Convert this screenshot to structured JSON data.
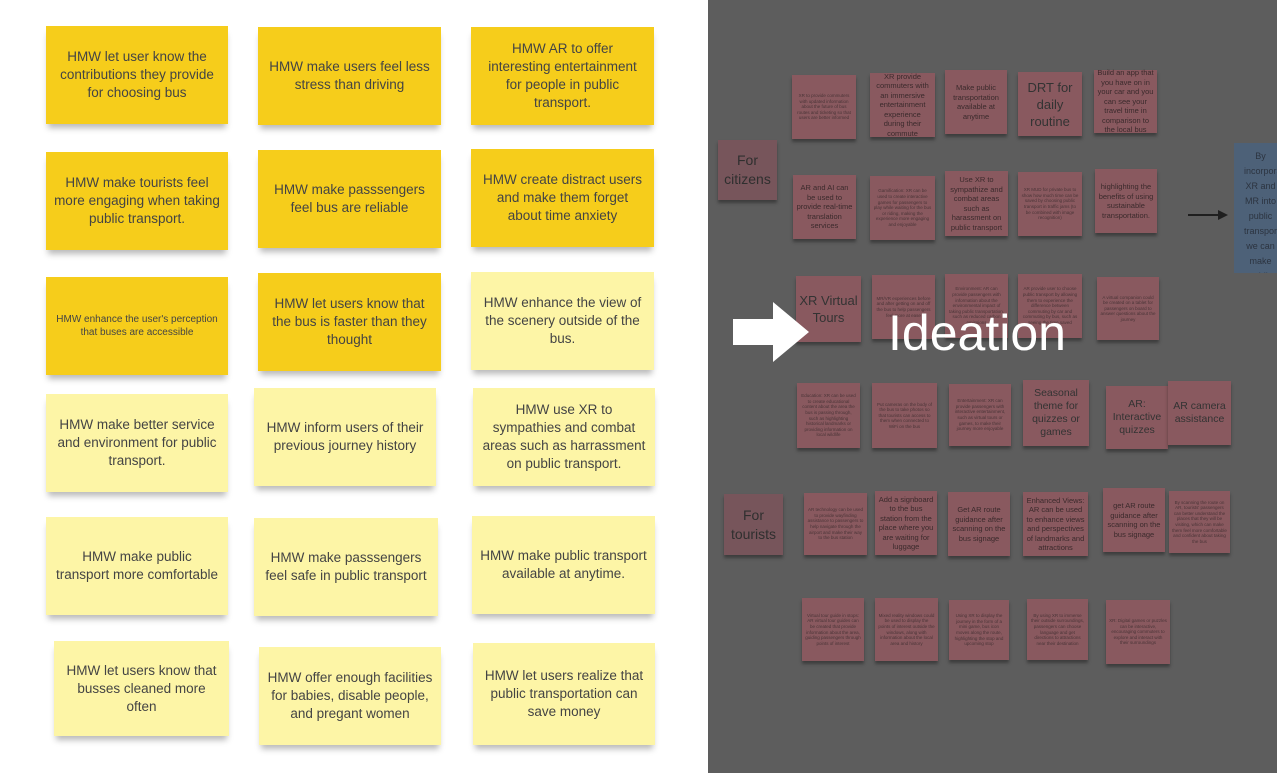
{
  "hmw_notes": [
    "HMW let user know the contributions they provide for choosing bus",
    "HMW make users feel less stress than driving",
    "HMW AR to offer interesting entertainment for people in public transport.",
    "HMW make tourists feel more engaging when taking public transport.",
    "HMW make passsengers feel bus are reliable",
    "HMW create distract users and make them forget about time anxiety",
    "HMW enhance the user's perception that buses are accessible",
    "HMW let users know that the bus is faster than they thought",
    "HMW enhance the view of the scenery outside of the bus.",
    "HMW make better service and environment for public transport.",
    "HMW inform users of their previous journey history",
    "HMW use XR to sympathies and combat areas such as harrassment on public transport.",
    "HMW make public transport more comfortable",
    "HMW make passsengers feel safe in public transport",
    "HMW make public transport available at anytime.",
    "HMW let users know that busses cleaned more often",
    "HMW offer enough facilities  for babies, disable people, and pregant women",
    "HMW let users realize that public transportation can save money"
  ],
  "ideation": {
    "title": "Ideation",
    "groups": {
      "citizens": "For citizens",
      "tourists": "For tourists"
    },
    "ideas": [
      "XR to provide commuters with updated information about the future of bus routes and ticketing so that users are better informed",
      "XR provide commuters with an immersive entertainment experience during their commute",
      "Make public transportation available at anytime",
      "DRT for daily routine",
      "Build an app that you have on in your car and you can see your travel time in comparison to the local bus",
      "AR and AI can be used to provide real-time translation services",
      "Gamification: XR can be used to create interactive games for passengers to play while waiting for the bus or riding, making the experience more engaging and enjoyable",
      "Use XR to sympathize and combat areas such as harassment on public transport",
      "XR MUD for private bus to show how much time can be saved by choosing public transport in traffic jams (to be combined with image recognition)",
      "highlighting the benefits of using sustainable transportation.",
      "XR Virtual Tours",
      "MR/VR experiences before and after getting on and off the bus to help passengers feel more at ease",
      "Environment: AR can provide passengers with information about the environmental impact of taking public transportation, such as reduced carbon emissions",
      "AR provide user to choose public transport by allowing them to experience the difference between commuting by car and commuting by bus, such as seeing the time saved",
      "A virtual companion could be created on a tablet for passengers on board to answer questions about the journey",
      "Education: XR can be used to create educational content about the area the bus is passing through, such as highlighting historical landmarks or providing information on local wildlife",
      "Put cameras on the body of the bus to take photos so that tourists can access to them when connected to WiFi on the bus",
      "Entertainment: XR can provide passengers with interactive entertainment, such as virtual tours or games, to make their journey more enjoyable",
      "Seasonal theme for quizzes or games",
      "AR: Interactive quizzes",
      "AR camera assistance",
      "AR technology can be used to provide wayfinding assistance to passengers to help navigate through the airport and make their way to the bus station",
      "Add a signboard to the bus station from the place where you are waiting for luggage",
      "Get AR route guidance after scanning on  the bus signage",
      "Enhanced Views: AR can be used to enhance views and perspectives of landmarks and attractions",
      "get AR route guidance after scanning on the bus signage",
      "By scanning the route on AR, tourists' passengers can better understand the places that they will be visiting, which can make them feel more comfortable and confident about taking the bus",
      "Virtual tour guide in stops: AR virtual tour guides can be created that provide information about the area, guiding passengers through points of interest",
      "Mixed reality windows could be used to display the points of interest outside the windows, along with information about the local area and history",
      "Using XR to display the journey in the form of a mini game, bus icon moves along the route, highlighting the stop and upcoming stop",
      "By using XR to immerse their outside surroundings, passengers can choose language and get directions to attractions near their destination",
      "XR: Digital games or puzzles can be interactive, encouraging commuters to explore and interact with their surroundings"
    ],
    "summary": "By incorporating XR and MR into public transport, we can make public transport more engaging and improve their experience, making it more enjoyable and..."
  },
  "colors": {
    "dark_note": "#f6cd1b",
    "light_note": "#fdf5a6",
    "overlay": "#5d5d5d",
    "idea_note": "#89595f",
    "summary_note": "#4d6178"
  }
}
